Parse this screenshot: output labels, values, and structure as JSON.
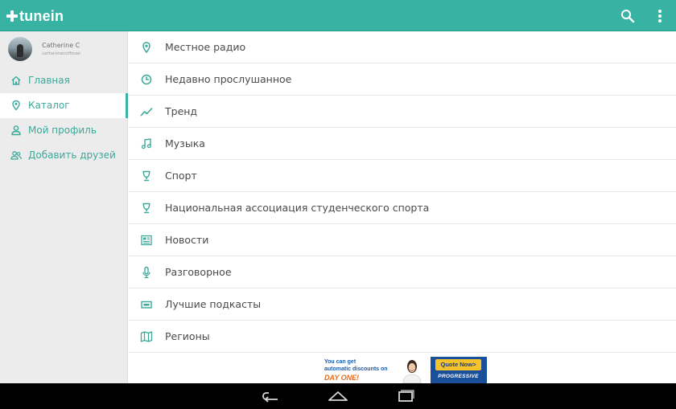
{
  "app": {
    "brand": "tunein",
    "accent_color": "#38b3a3",
    "icons": {
      "search": "search-icon",
      "overflow": "more-vert-icon"
    }
  },
  "profile": {
    "name": "Catherine C",
    "handle": "catherinecoffman"
  },
  "sidebar": {
    "items": [
      {
        "label": "Главная",
        "icon": "home-icon",
        "active": false
      },
      {
        "label": "Каталог",
        "icon": "location-pin-icon",
        "active": true
      },
      {
        "label": "Мой профиль",
        "icon": "person-icon",
        "active": false
      },
      {
        "label": "Добавить друзей",
        "icon": "add-friends-icon",
        "active": false
      }
    ]
  },
  "categories": [
    {
      "label": "Местное радио",
      "icon": "location-pin-icon"
    },
    {
      "label": "Недавно прослушанное",
      "icon": "clock-icon"
    },
    {
      "label": "Тренд",
      "icon": "trend-icon"
    },
    {
      "label": "Музыка",
      "icon": "music-note-icon"
    },
    {
      "label": "Спорт",
      "icon": "trophy-icon"
    },
    {
      "label": "Национальная ассоциация студенческого спорта",
      "icon": "trophy-icon"
    },
    {
      "label": "Новости",
      "icon": "newspaper-icon"
    },
    {
      "label": "Разговорное",
      "icon": "microphone-icon"
    },
    {
      "label": "Лучшие подкасты",
      "icon": "podcast-icon"
    },
    {
      "label": "Регионы",
      "icon": "map-icon"
    }
  ],
  "ad": {
    "line1": "You can get",
    "line2": "automatic discounts on",
    "line3": "DAY ONE!",
    "cta": "Quote Now>",
    "brand": "PROGRESSIVE"
  },
  "system_nav": {
    "icons": [
      "back-icon",
      "home-icon",
      "recents-icon"
    ]
  }
}
